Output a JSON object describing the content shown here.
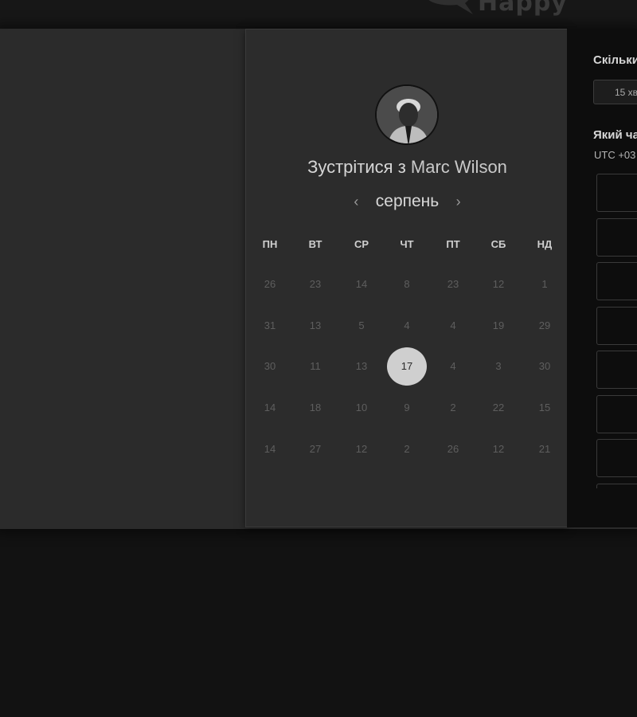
{
  "header": {
    "logo_text": "Happy"
  },
  "booking": {
    "title_prefix": "Зустрітися з",
    "host_name": "Marc Wilson",
    "month": "серпень",
    "prev_label": "‹",
    "next_label": "›",
    "weekdays": [
      "ПН",
      "ВТ",
      "СР",
      "ЧТ",
      "ПТ",
      "СБ",
      "НД"
    ],
    "weeks": [
      [
        "26",
        "23",
        "14",
        "8",
        "23",
        "12",
        "1"
      ],
      [
        "31",
        "13",
        "5",
        "4",
        "4",
        "19",
        "29"
      ],
      [
        "30",
        "11",
        "13",
        "17",
        "4",
        "3",
        "30"
      ],
      [
        "14",
        "18",
        "10",
        "9",
        "2",
        "22",
        "15"
      ],
      [
        "14",
        "27",
        "12",
        "2",
        "26",
        "12",
        "21"
      ]
    ],
    "selected_day": "17"
  },
  "side": {
    "duration_question": "Скільки",
    "duration_value": "15 хв",
    "time_question": "Який ча",
    "timezone": "UTC +03",
    "slot_count_visible": 8
  }
}
